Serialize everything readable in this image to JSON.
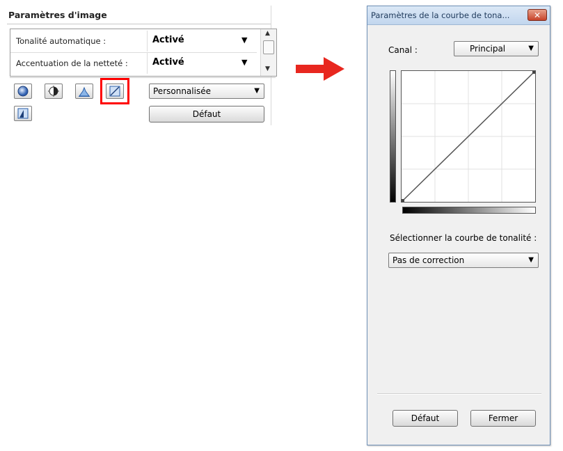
{
  "left_panel": {
    "title": "Paramètres d'image",
    "settings": [
      {
        "label": "Tonalité automatique :",
        "value": "Activé"
      },
      {
        "label": "Accentuation de la netteté :",
        "value": "Activé"
      }
    ],
    "preset_value": "Personnalisée",
    "default_label": "Défaut",
    "tool_icons": [
      "brightness-icon",
      "contrast-icon",
      "histogram-icon",
      "tone-curve-icon",
      "threshold-icon"
    ]
  },
  "arrow_color": "#e8271f",
  "tone_curve_window": {
    "title": "Paramètres de la courbe de tona...",
    "close_glyph": "✕",
    "channel_label": "Canal :",
    "channel_value": "Principal",
    "curve_select_label": "Sélectionner la courbe de tonalité :",
    "curve_value": "Pas de correction",
    "default_label": "Défaut",
    "close_label": "Fermer"
  },
  "colors": {
    "highlight": "#ff0000",
    "title_bar": "#c2d6ee"
  }
}
